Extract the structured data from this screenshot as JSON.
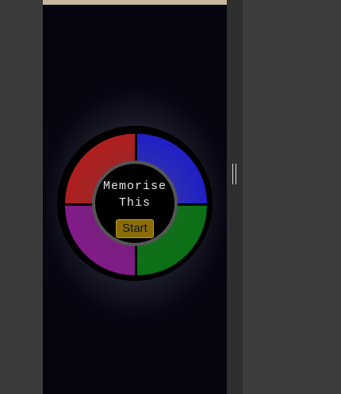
{
  "game": {
    "title_line1": "Memorise",
    "title_line2": "This",
    "start_label": "Start",
    "quadrants": [
      {
        "name": "red",
        "color": "#c01818"
      },
      {
        "name": "blue",
        "color": "#1212d6"
      },
      {
        "name": "purple",
        "color": "#8a1690"
      },
      {
        "name": "green",
        "color": "#067010"
      }
    ],
    "button_color": "#8a6d08",
    "background_color": "#050510"
  }
}
